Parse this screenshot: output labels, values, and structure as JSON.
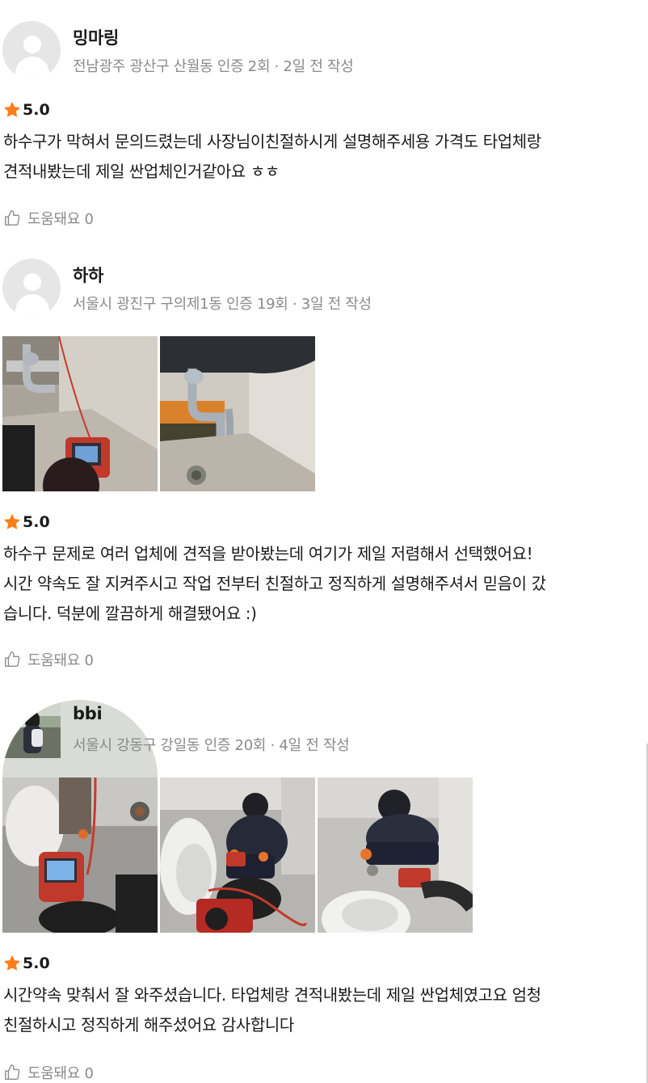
{
  "reviews": [
    {
      "name": "밍마링",
      "meta": "전남광주 광산구 산월동 인증 2회 · 2일 전 작성",
      "rating": "5.0",
      "text": [
        "하수구가 막혀서 문의드렸는데 사장님이친절하시게 설명해주세용 가격도 타업체랑",
        "견적내봤는데 제일 싼업체인거같아요 ㅎㅎ"
      ],
      "helpful": "도움돼요 0"
    },
    {
      "name": "하하",
      "meta": "서울시 광진구 구의제1동 인증 19회 · 3일 전 작성",
      "rating": "5.0",
      "text": [
        "하수구 문제로 여러 업체에 견적을 받아봤는데 여기가 제일 저렴해서 선택했어요!",
        "시간 약속도 잘 지켜주시고 작업 전부터 친절하고 정직하게 설명해주셔서 믿음이 갔",
        "습니다. 덕분에 깔끔하게 해결됐어요 :)"
      ],
      "helpful": "도움돼요 0"
    },
    {
      "name": "bbi",
      "meta": "서울시 강동구 강일동 인증 20회 · 4일 전 작성",
      "rating": "5.0",
      "text": [
        "시간약속 맞춰서 잘 와주셨습니다. 타업체랑 견적내봤는데 제일 싼업체였고요 엄청",
        "친절하시고 정직하게 해주셨어요 감사합니다"
      ],
      "helpful": "도움돼요 0"
    }
  ],
  "colors": {
    "star": "#ff7e1b",
    "meta_text": "#8a8a8a",
    "avatar_placeholder": "#e6e6e6"
  },
  "icons": {
    "star": "star-icon",
    "helpful": "thumbs-up-icon",
    "avatar": "default-avatar-icon"
  }
}
